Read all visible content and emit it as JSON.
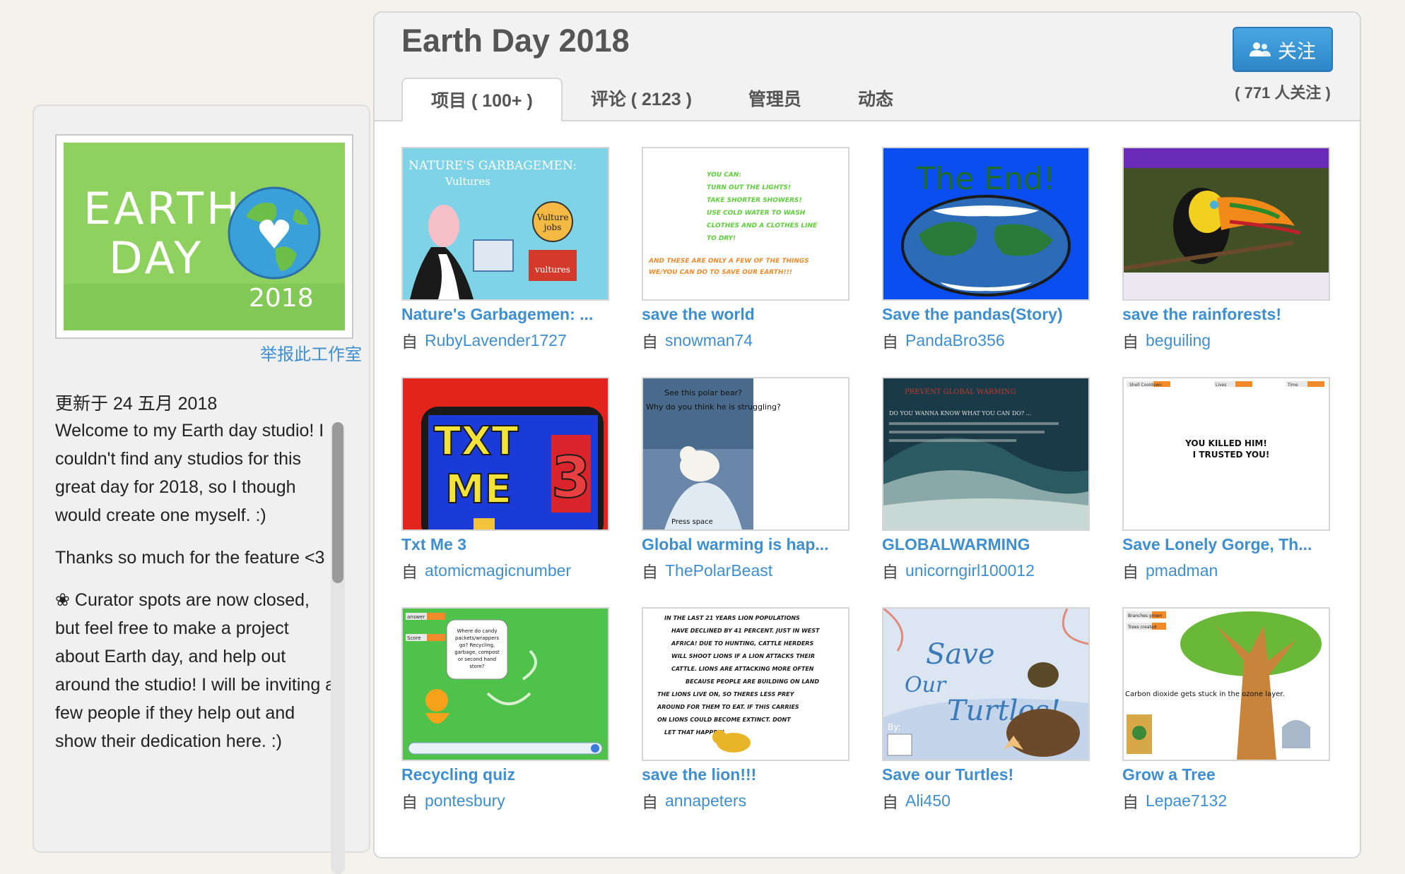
{
  "studio": {
    "title": "Earth Day 2018",
    "follow_label": "关注",
    "follow_count": "( 771 人关注 )",
    "report_link": "举报此工作室",
    "updated": "更新于 24 五月 2018",
    "description": [
      "Welcome to my Earth day studio! I couldn't find any studios for this great day for 2018, so I though would create one myself. :)",
      "Thanks so much for the feature <3",
      "❀ Curator spots are now closed, but feel free to make a project about Earth day, and help out around the studio! I will be inviting a few people if they help out and show their dedication here. :)"
    ],
    "thumb": {
      "word1": "EARTH",
      "word2": "DAY",
      "year": "2018"
    }
  },
  "tabs": [
    {
      "label": "项目 ( 100+ )",
      "active": true
    },
    {
      "label": "评论 ( 2123 )",
      "active": false
    },
    {
      "label": "管理员",
      "active": false
    },
    {
      "label": "动态",
      "active": false
    }
  ],
  "by_label": "自",
  "projects": [
    {
      "title": "Nature's Garbagemen: ...",
      "author": "RubyLavender1727"
    },
    {
      "title": "save the world",
      "author": "snowman74"
    },
    {
      "title": "Save the pandas(Story)",
      "author": "PandaBro356"
    },
    {
      "title": "save the rainforests!",
      "author": "beguiling"
    },
    {
      "title": "Txt Me 3",
      "author": "atomicmagicnumber"
    },
    {
      "title": "Global warming is hap...",
      "author": "ThePolarBeast"
    },
    {
      "title": "GLOBALWARMING",
      "author": "unicorngirl100012"
    },
    {
      "title": "Save Lonely Gorge, Th...",
      "author": "pmadman"
    },
    {
      "title": "Recycling quiz",
      "author": "pontesbury"
    },
    {
      "title": "save the lion!!!",
      "author": "annapeters"
    },
    {
      "title": "Save our Turtles!",
      "author": "Ali450"
    },
    {
      "title": "Grow a Tree",
      "author": "Lepae7132"
    }
  ],
  "thumb_text": {
    "p1_title": "NATURE'S GARBAGEMEN:",
    "p1_sub": "Vultures",
    "p1_circle": "Vulture jobs",
    "p1_box": "vultures",
    "p2_lines": [
      "YOU CAN:",
      "TURN OUT THE LIGHTS!",
      "TAKE SHORTER SHOWERS!",
      "USE COLD WATER TO WASH",
      "CLOTHES AND A CLOTHES LINE",
      "TO DRY!",
      "AND THESE ARE ONLY A FEW OF THE THINGS",
      "WE/YOU CAN DO TO SAVE OUR EARTH!!!"
    ],
    "p3_text": "The End!",
    "p5_line1": "TXT",
    "p5_line2": "ME",
    "p5_num": "3",
    "p6_line1": "See this polar bear?",
    "p6_line2": "Why do you think he is struggling?",
    "p6_bottom": "Press space",
    "p7_head": "PREVENT GLOBAL WARMING",
    "p7_body": "DO YOU WANNA KNOW WHAT YOU CAN DO? ...",
    "p8_labels": [
      "Shell Cooldown",
      "Lives",
      "Time"
    ],
    "p8_line1": "YOU KILLED HIM!",
    "p8_line2": "I TRUSTED YOU!",
    "p9_bubble": "Where do candy packets/wrappers go? Recycling, garbage, compost or second hand store?",
    "p9_labels": [
      "answer",
      "Score"
    ],
    "p10_lines": [
      "IN THE LAST 21 YEARS LION POPULATIONS",
      "HAVE DECLINED BY 41 PERCENT. JUST IN WEST",
      "AFRICA! DUE TO HUNTING, CATTLE HERDERS",
      "WILL SHOOT LIONS IF A LION ATTACKS THEIR",
      "CATTLE. LIONS ARE ATTACKING MORE OFTEN",
      "BECAUSE PEOPLE ARE BUILDING ON LAND",
      "THE LIONS LIVE ON, SO THERES LESS PREY",
      "AROUND FOR THEM TO EAT. IF THIS CARRIES",
      "ON LIONS COULD BECOME EXTINCT. DONT",
      "LET THAT HAPPEN!"
    ],
    "p11_line1": "Save",
    "p11_line2": "Our",
    "p11_line3": "Turtles!",
    "p11_by": "By:",
    "p12_labels": [
      "Branches grown",
      "Trees created"
    ],
    "p12_caption": "Carbon dioxide gets stuck in the ozone layer."
  },
  "colors": {
    "link": "#3d8fd1",
    "follow_button": "#2e86c8",
    "sidebar_bg": "#f0f0f0"
  }
}
